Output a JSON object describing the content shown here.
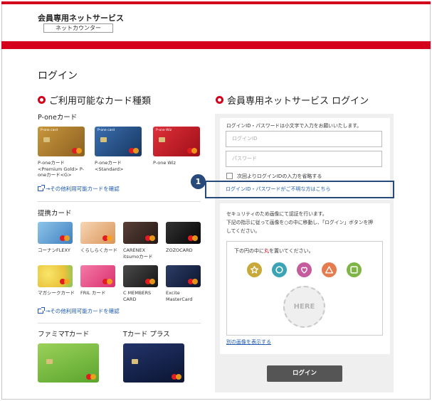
{
  "header": {
    "brand": "会員専用ネットサービス",
    "counter": "ネットカウンター"
  },
  "page_title": "ログイン",
  "left": {
    "section_title": "ご利用可能なカード種類",
    "pone": {
      "title": "P-oneカード",
      "cards": [
        {
          "caption": "P-oneカード\n<Premium Gold> P-\noneカード<G>",
          "color": "#b3822f",
          "label": "P-one card"
        },
        {
          "caption": "P-oneカード\n<Standard>",
          "color": "#1f4f86",
          "label": "P-one card"
        },
        {
          "caption": "P-one Wiz",
          "color": "#c4121d",
          "label": "P-one Wiz"
        }
      ],
      "more_link": "→その他利用可能カードを確認"
    },
    "partner": {
      "title": "提携カード",
      "cards": [
        {
          "caption": "コーナンFLEXY",
          "color": "#6aa6d8"
        },
        {
          "caption": "くらしらくカード",
          "color": "#e8b080"
        },
        {
          "caption": "CARENEX\nitsumoカード",
          "color": "#3b2a26"
        },
        {
          "caption": "ZOZOCARD",
          "color": "#1a1a1a"
        },
        {
          "caption": "マガシークカード",
          "color": "#f2d84b"
        },
        {
          "caption": "FRIL カード",
          "color": "#e8508a"
        },
        {
          "caption": "C MEMBERS\nCARD",
          "color": "#2c2c2c"
        },
        {
          "caption": "Excite\nMasterCard",
          "color": "#1c2a4a"
        }
      ],
      "more_link": "→その他利用可能カードを確認"
    },
    "famima": {
      "title": "ファミマTカード",
      "color": "#7fc241"
    },
    "tcard": {
      "title": "Tカード プラス",
      "color": "#14214a"
    }
  },
  "right": {
    "section_title": "会員専用ネットサービス ログイン",
    "note": "ログインID・パスワードは小文字で入力をお願いいたします。",
    "id_placeholder": "ログインID",
    "password_placeholder": "パスワード",
    "remember_label": "次回よりログインIDの入力を省略する",
    "forgot_link": "ログインID・パスワードがご不明な方はこちら",
    "badge": "1",
    "security_note_1": "セキュリティのため画像にて認証を行います。",
    "security_note_2": "下記の指示に従って画像を○の中に移動し、「ログイン」ボタンを押",
    "security_note_3": "してください。",
    "captcha_instruction_pre": "下の円の中に",
    "captcha_instruction_red": "丸",
    "captcha_instruction_post": "を置いてください。",
    "shapes": [
      {
        "icon": "star-icon",
        "color": "#c8a93a"
      },
      {
        "icon": "circle-icon",
        "color": "#3aa3b5"
      },
      {
        "icon": "heart-icon",
        "color": "#c45c9e"
      },
      {
        "icon": "triangle-icon",
        "color": "#e57c4f"
      },
      {
        "icon": "square-icon",
        "color": "#7fb446"
      }
    ],
    "drop_zone": "HERE",
    "alt_link": "別の画像を表示する",
    "login_button": "ログイン"
  }
}
